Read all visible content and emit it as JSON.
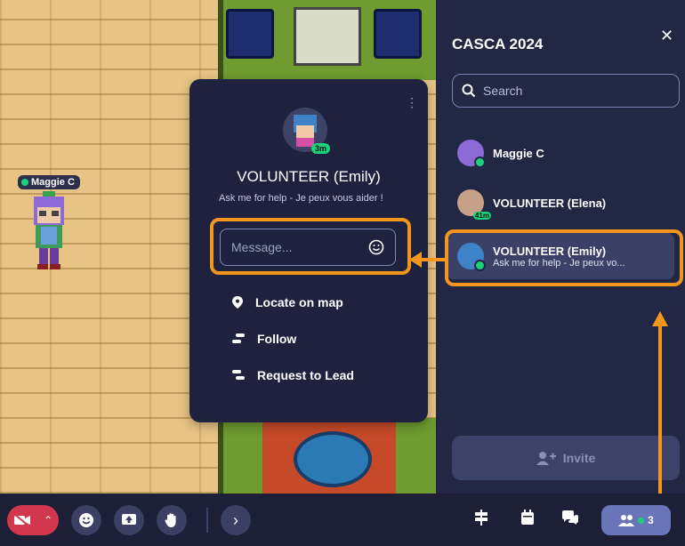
{
  "map": {
    "player_name": "Maggie C"
  },
  "sidebar": {
    "title": "CASCA 2024",
    "search_placeholder": "Search",
    "members": [
      {
        "name": "Maggie C",
        "subtitle": "",
        "status": "online"
      },
      {
        "name": "VOLUNTEER (Elena)",
        "subtitle": "",
        "status": "idle",
        "idle_badge": "41m"
      },
      {
        "name": "VOLUNTEER (Emily)",
        "subtitle": "Ask me for help - Je peux vo...",
        "status": "online",
        "selected": true
      }
    ],
    "invite_label": "Invite"
  },
  "popup": {
    "name": "VOLUNTEER (Emily)",
    "status_text": "Ask me for help - Je peux vous aider !",
    "idle_badge": "3m",
    "message_placeholder": "Message...",
    "actions": [
      "Locate on map",
      "Follow",
      "Request to Lead"
    ]
  },
  "bottombar": {
    "participant_count": "3"
  },
  "colors": {
    "highlight": "#f4961e",
    "panel_bg": "#222744",
    "online": "#1bd17c",
    "camera_off": "#d2374d"
  }
}
